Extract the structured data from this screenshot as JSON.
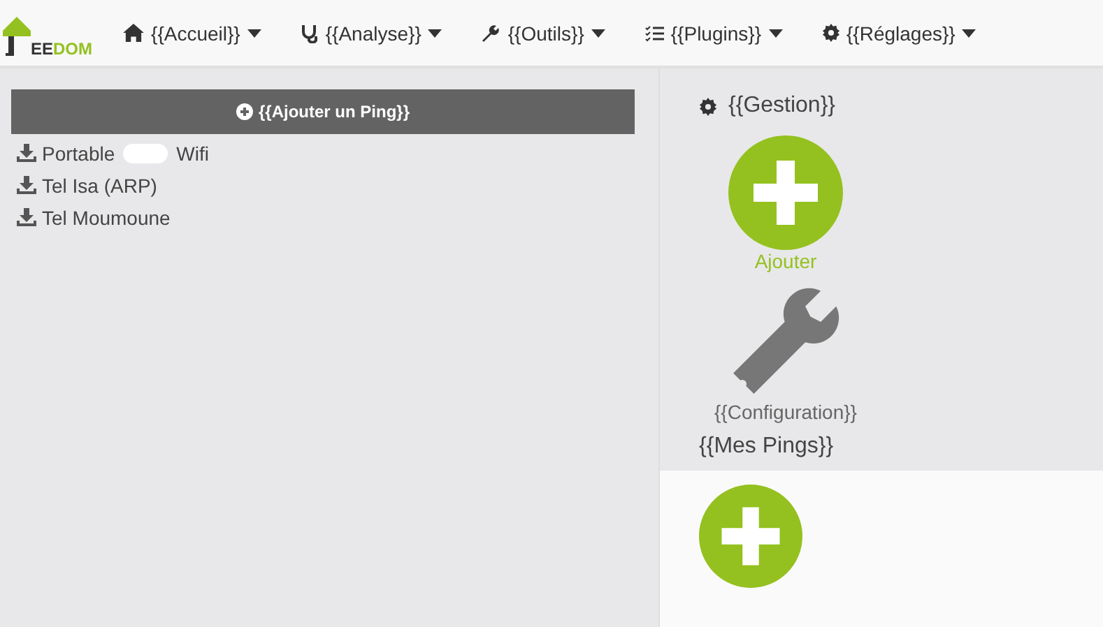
{
  "navbar": {
    "logo": {
      "part_1": "EE",
      "part_2": "DOM"
    },
    "menus": [
      {
        "label": "{{Accueil}}"
      },
      {
        "label": "{{Analyse}}"
      },
      {
        "label": "{{Outils}}"
      },
      {
        "label": "{{Plugins}}"
      },
      {
        "label": "{{Réglages}}"
      }
    ]
  },
  "sidebar": {
    "add_button": "{{Ajouter un Ping}}",
    "items": [
      {
        "label": "Portable Wifi",
        "redacted": true
      },
      {
        "label": "Tel Isa (ARP)",
        "redacted": false
      },
      {
        "label": "Tel Moumoune",
        "redacted": false
      }
    ]
  },
  "gestion": {
    "title": "{{Gestion}}",
    "cards": [
      {
        "kind": "add",
        "label": "Ajouter"
      },
      {
        "kind": "config",
        "label": "{{Configuration}}"
      }
    ]
  },
  "pings": {
    "title": "{{Mes Pings}}"
  }
}
